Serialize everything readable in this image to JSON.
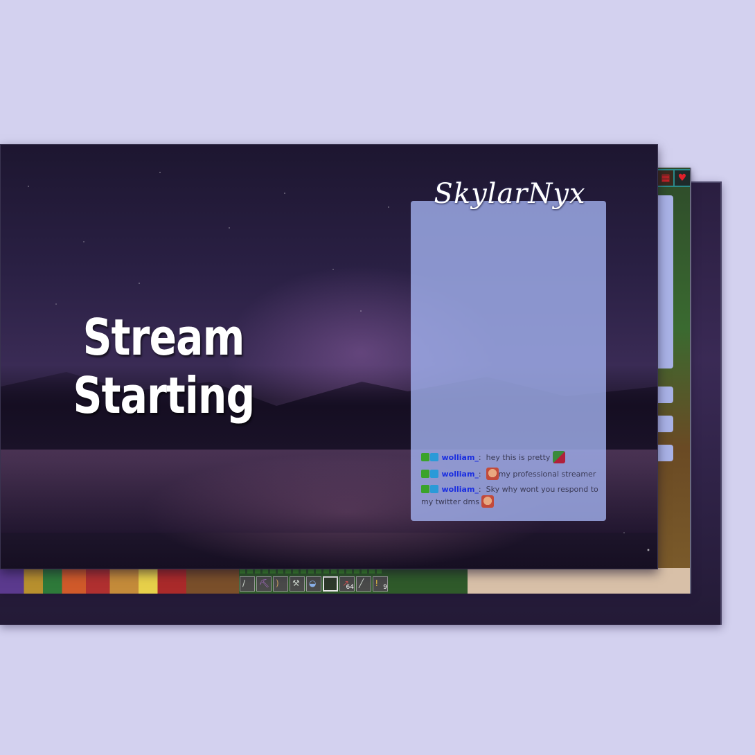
{
  "overlay": {
    "title_line1": "Stream",
    "title_line2": "Starting",
    "streamer_name": "SkylarNyx"
  },
  "chat": {
    "messages": [
      {
        "user": "wolliam_",
        "separator": ":",
        "text": "hey this is pretty",
        "emote": "frog-emote"
      },
      {
        "user": "wolliam_",
        "separator": ":",
        "text": "my professional streamer",
        "emote": "face-emote"
      },
      {
        "user": "wolliam_",
        "separator": ":",
        "text": "Sky why wont you respond to my twitter dms",
        "emote": "face-emote"
      }
    ],
    "badges": [
      "moderator-badge",
      "subscriber-badge"
    ]
  },
  "hotbar": {
    "slots": [
      {
        "icon": "sword-icon",
        "count": ""
      },
      {
        "icon": "pickaxe-icon",
        "count": ""
      },
      {
        "icon": "bow-icon",
        "count": ""
      },
      {
        "icon": "axe-icon",
        "count": ""
      },
      {
        "icon": "bucket-icon",
        "count": ""
      },
      {
        "icon": "empty-slot",
        "count": "",
        "selected": true
      },
      {
        "icon": "arrow-icon",
        "count": "64"
      },
      {
        "icon": "shovel-icon",
        "count": ""
      },
      {
        "icon": "torch-icon",
        "count": "9"
      }
    ]
  },
  "colors": {
    "background": "#d3d1ef",
    "chat_panel": "#a0afeb",
    "username": "#1a2ee0"
  }
}
